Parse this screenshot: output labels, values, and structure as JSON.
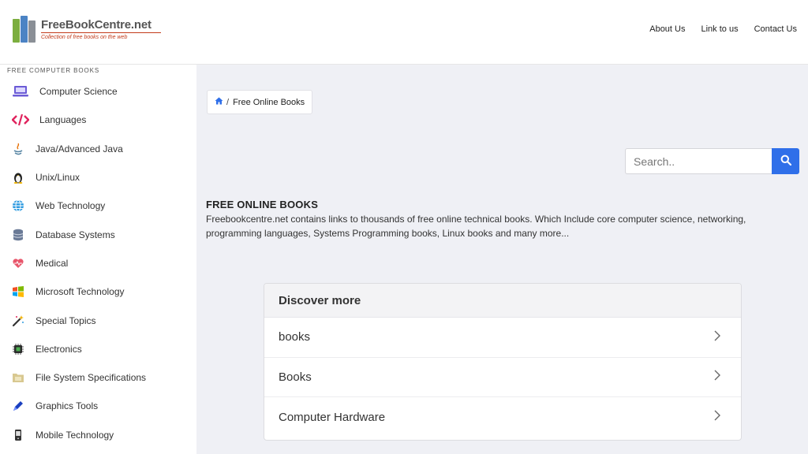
{
  "header": {
    "logo_title": "FreeBookCentre.net",
    "logo_tagline": "Collection of free books on the web",
    "nav": [
      "About Us",
      "Link to us",
      "Contact Us"
    ]
  },
  "sidebar": {
    "heading": "FREE COMPUTER BOOKS",
    "items": [
      {
        "label": "Computer Science",
        "icon": "laptop-icon"
      },
      {
        "label": "Languages",
        "icon": "code-icon"
      },
      {
        "label": "Java/Advanced Java",
        "icon": "java-icon"
      },
      {
        "label": "Unix/Linux",
        "icon": "linux-penguin-icon"
      },
      {
        "label": "Web Technology",
        "icon": "globe-icon"
      },
      {
        "label": "Database Systems",
        "icon": "database-icon"
      },
      {
        "label": "Medical",
        "icon": "heart-icon"
      },
      {
        "label": "Microsoft Technology",
        "icon": "windows-icon"
      },
      {
        "label": "Special Topics",
        "icon": "magic-wand-icon"
      },
      {
        "label": "Electronics",
        "icon": "chip-icon"
      },
      {
        "label": "File System Specifications",
        "icon": "folder-icon"
      },
      {
        "label": "Graphics Tools",
        "icon": "pen-icon"
      },
      {
        "label": "Mobile Technology",
        "icon": "mobile-phone-icon"
      }
    ]
  },
  "breadcrumb": {
    "separator": "/",
    "current": "Free Online Books"
  },
  "search": {
    "placeholder": "Search.."
  },
  "intro": {
    "title": "FREE ONLINE BOOKS",
    "text": "Freebookcentre.net contains links to thousands of free online technical books. Which Include core computer science, networking, programming languages, Systems Programming books, Linux books and many more..."
  },
  "discover": {
    "heading": "Discover more",
    "items": [
      "books",
      "Books",
      "Computer Hardware"
    ]
  },
  "colors": {
    "accent": "#2f6fe9",
    "main_bg": "#eff0f5",
    "logo_red": "#c23a1a"
  }
}
